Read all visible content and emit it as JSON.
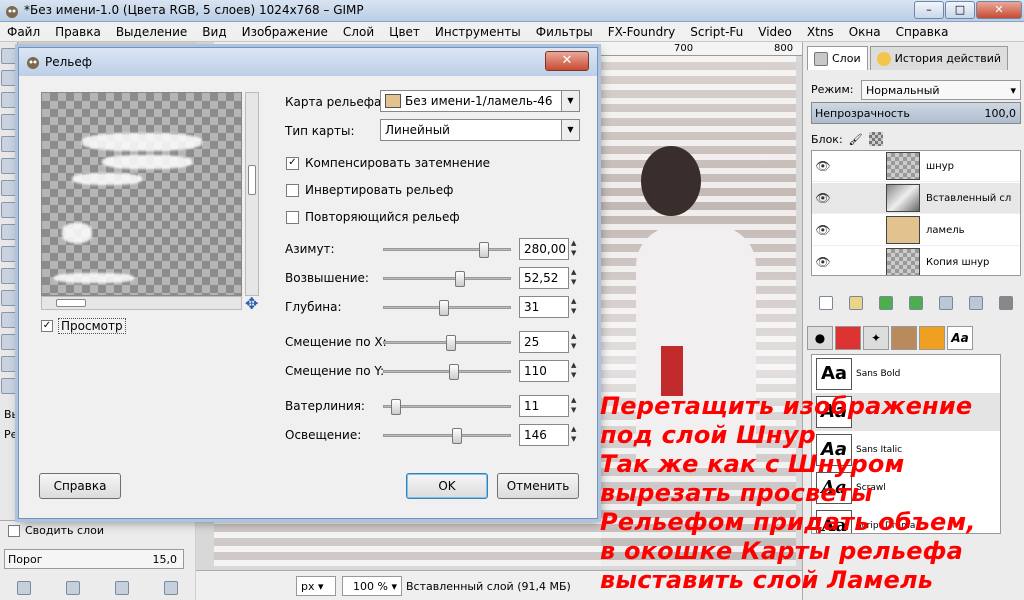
{
  "window": {
    "title": "*Без имени-1.0 (Цвета RGB, 5 слоев) 1024x768 – GIMP"
  },
  "menu": [
    "Файл",
    "Правка",
    "Выделение",
    "Вид",
    "Изображение",
    "Слой",
    "Цвет",
    "Инструменты",
    "Фильтры",
    "FX-Foundry",
    "Script-Fu",
    "Video",
    "Xtns",
    "Окна",
    "Справка"
  ],
  "ruler": {
    "ticks": [
      "700",
      "800"
    ]
  },
  "tool_options": {
    "label_vy": "Вы",
    "label_re": "Ре",
    "merge_label": "Сводить слои",
    "threshold_label": "Порог",
    "threshold_value": "15,0"
  },
  "status": {
    "unit": "px",
    "zoom": "100 %",
    "text": "Вставленный слой (91,4 МБ)"
  },
  "dialog": {
    "title": "Рельеф",
    "preview_label": "Просмотр",
    "map_label": "Карта рельефа:",
    "map_value": "Без имени-1/ламель-46",
    "type_label": "Тип карты:",
    "type_value": "Линейный",
    "checkboxes": [
      {
        "label": "Компенсировать затемнение",
        "checked": true
      },
      {
        "label": "Инвертировать рельеф",
        "checked": false
      },
      {
        "label": "Повторяющийся рельеф",
        "checked": false
      }
    ],
    "sliders": [
      {
        "label": "Азимут:",
        "value": "280,00",
        "pos": 0.78
      },
      {
        "label": "Возвышение:",
        "value": "52,52",
        "pos": 0.59
      },
      {
        "label": "Глубина:",
        "value": "31",
        "pos": 0.47
      },
      {
        "label": "Смещение по X:",
        "value": "25",
        "pos": 0.52
      },
      {
        "label": "Смещение по Y:",
        "value": "110",
        "pos": 0.55
      },
      {
        "label": "Ватерлиния:",
        "value": "11",
        "pos": 0.09
      },
      {
        "label": "Освещение:",
        "value": "146",
        "pos": 0.57
      }
    ],
    "help_button": "Справка",
    "ok_button": "OK",
    "cancel_button": "Отменить"
  },
  "layers_dock": {
    "tab_layers": "Слои",
    "tab_history": "История действий",
    "mode_label": "Режим:",
    "mode_value": "Нормальный",
    "opacity_label": "Непрозрачность",
    "opacity_value": "100,0",
    "lock_label": "Блок:",
    "layers": [
      {
        "name": "шнур",
        "thumb": "check"
      },
      {
        "name": "Вставленный сл",
        "thumb": "img"
      },
      {
        "name": "ламель",
        "thumb": "wood"
      },
      {
        "name": "Копия шнур",
        "thumb": "check"
      }
    ]
  },
  "fonts_dock": {
    "tab_glyph": "Aa",
    "glyph": "Aa",
    "fonts": [
      "Sans Bold",
      "",
      "Sans Italic",
      "Scrawl",
      "Script Drama"
    ]
  },
  "note": {
    "color": "#ff0000",
    "lines": [
      "Перетащить изображение",
      "под слой Шнур",
      "Так же как с Шнуром",
      "вырезать просветы",
      "Рельефом придать объем,",
      "в окошке Карты рельефа",
      "выставить слой Ламель"
    ]
  }
}
